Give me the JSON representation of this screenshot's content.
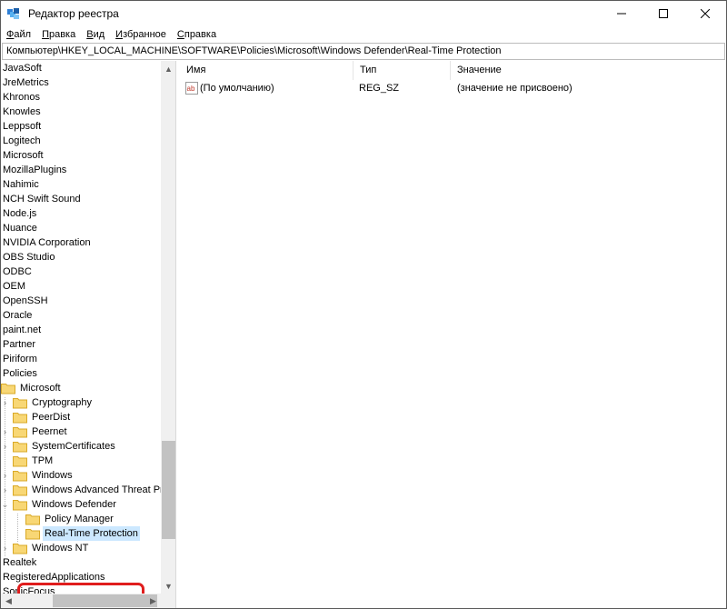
{
  "window": {
    "title": "Редактор реестра"
  },
  "menu": [
    {
      "label": "Файл",
      "underline": "Ф",
      "rest": "айл"
    },
    {
      "label": "Правка",
      "underline": "П",
      "rest": "равка"
    },
    {
      "label": "Вид",
      "underline": "В",
      "rest": "ид"
    },
    {
      "label": "Избранное",
      "underline": "И",
      "rest": "збранное"
    },
    {
      "label": "Справка",
      "underline": "С",
      "rest": "правка"
    }
  ],
  "address": "Компьютер\\HKEY_LOCAL_MACHINE\\SOFTWARE\\Policies\\Microsoft\\Windows Defender\\Real-Time Protection",
  "tree": {
    "items": [
      {
        "label": "JavaSoft"
      },
      {
        "label": "JreMetrics"
      },
      {
        "label": "Khronos"
      },
      {
        "label": "Knowles"
      },
      {
        "label": "Leppsoft"
      },
      {
        "label": "Logitech"
      },
      {
        "label": "Microsoft"
      },
      {
        "label": "MozillaPlugins"
      },
      {
        "label": "Nahimic"
      },
      {
        "label": "NCH Swift Sound"
      },
      {
        "label": "Node.js"
      },
      {
        "label": "Nuance"
      },
      {
        "label": "NVIDIA Corporation"
      },
      {
        "label": "OBS Studio"
      },
      {
        "label": "ODBC"
      },
      {
        "label": "OEM"
      },
      {
        "label": "OpenSSH"
      },
      {
        "label": "Oracle"
      },
      {
        "label": "paint.net"
      },
      {
        "label": "Partner"
      },
      {
        "label": "Piriform"
      },
      {
        "label": "Policies"
      },
      {
        "label": "Microsoft"
      },
      {
        "label": "Cryptography"
      },
      {
        "label": "PeerDist"
      },
      {
        "label": "Peernet"
      },
      {
        "label": "SystemCertificates"
      },
      {
        "label": "TPM"
      },
      {
        "label": "Windows"
      },
      {
        "label": "Windows Advanced Threat Prot"
      },
      {
        "label": "Windows Defender"
      },
      {
        "label": "Policy Manager"
      },
      {
        "label": "Real-Time Protection"
      },
      {
        "label": "Windows NT"
      },
      {
        "label": "Realtek"
      },
      {
        "label": "RegisteredApplications"
      },
      {
        "label": "SonicFocus"
      }
    ]
  },
  "columns": {
    "name": "Имя",
    "type": "Тип",
    "value": "Значение"
  },
  "values": [
    {
      "name": "(По умолчанию)",
      "type": "REG_SZ",
      "data": "(значение не присвоено)"
    }
  ],
  "colors": {
    "selection": "#cce8ff",
    "highlight_ring": "#e01d1d",
    "folder": "#f8d775"
  }
}
